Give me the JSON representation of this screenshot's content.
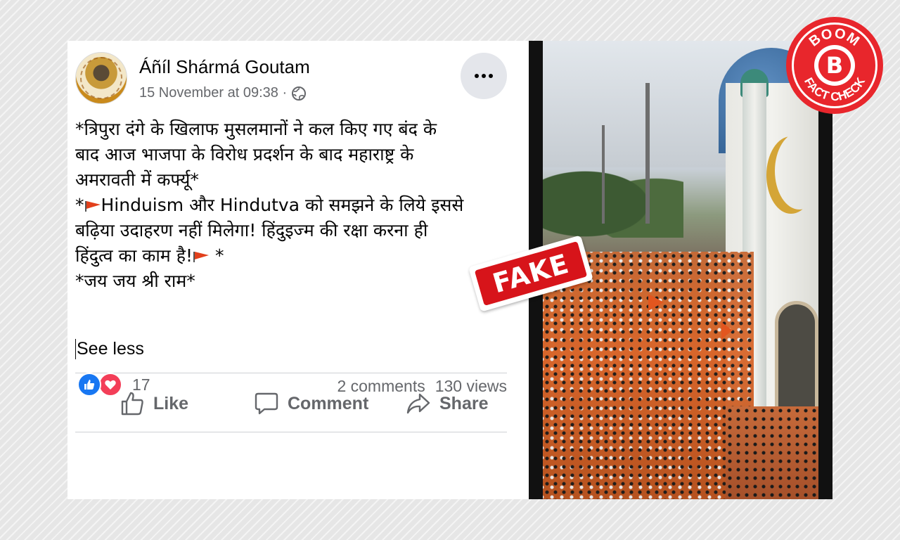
{
  "post": {
    "author": "Áñíl Shármá Goutam",
    "timestamp": "15 November at 09:38 ·",
    "privacy_icon": "globe-icon",
    "text_lines": [
      "*त्रिपुरा दंगे के खिलाफ मुसलमानों ने कल किए गए बंद के",
      "बाद आज भाजपा के विरोध प्रदर्शन के बाद महाराष्ट्र के",
      "अमरावती में कर्फ्यू*",
      "Hinduism और Hindutva को समझने के लिये इससे",
      "बढ़िया उदाहरण नहीं मिलेगा! हिंदुइज्म की रक्षा करना ही",
      "हिंदुत्व का काम है!",
      "*जय जय श्री राम*"
    ],
    "line4_prefix": "*",
    "line6_suffix": "*",
    "see_less": "See less",
    "reaction_count": "17",
    "comments": "2 comments",
    "views": "130 views",
    "actions": {
      "like": "Like",
      "comment": "Comment",
      "share": "Share"
    }
  },
  "stamp": {
    "label": "FAKE"
  },
  "badge": {
    "top_text": "BOOM",
    "letter": "B",
    "bottom_text": "FACT CHECK"
  },
  "colors": {
    "facebook_blue": "#1877f2",
    "love_red": "#f33e58",
    "stamp_red": "#d7141a",
    "boom_red": "#e8262c"
  }
}
